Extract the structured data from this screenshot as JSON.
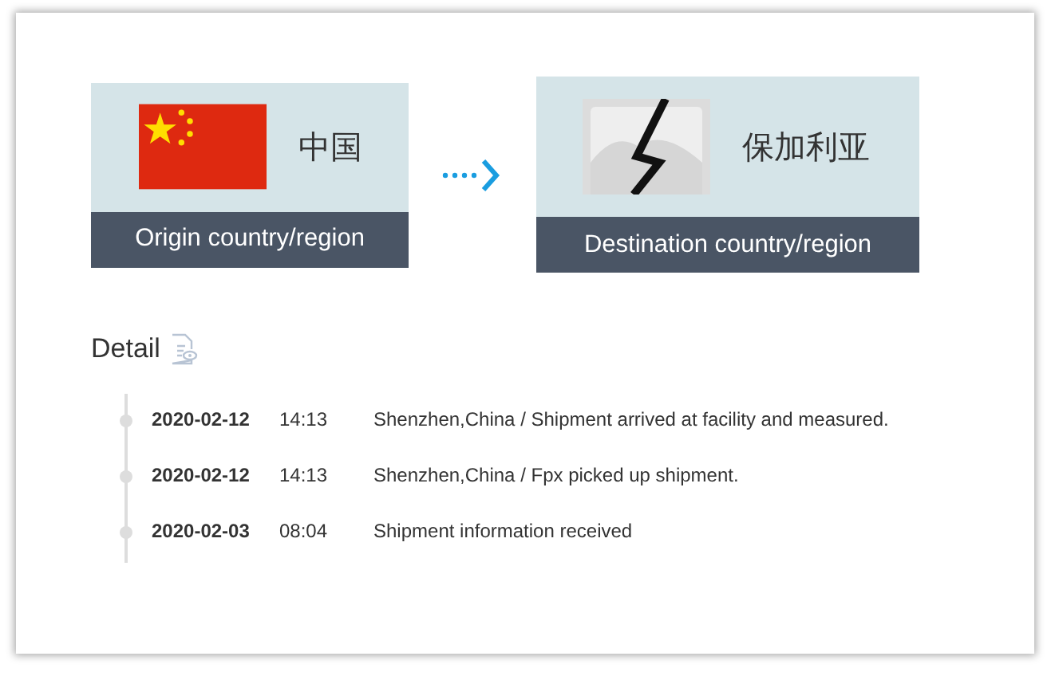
{
  "route": {
    "origin": {
      "kind": "flag",
      "name": "中国",
      "label": "Origin country/region"
    },
    "destination": {
      "kind": "broken",
      "name": "保加利亚",
      "label": "Destination country/region"
    }
  },
  "detail": {
    "title": "Detail",
    "events": [
      {
        "date": "2020-02-12",
        "time": "14:13",
        "description": "Shenzhen,China / Shipment arrived at facility and measured."
      },
      {
        "date": "2020-02-12",
        "time": "14:13",
        "description": "Shenzhen,China / Fpx picked up shipment."
      },
      {
        "date": "2020-02-03",
        "time": "08:04",
        "description": "Shipment information received"
      }
    ]
  }
}
